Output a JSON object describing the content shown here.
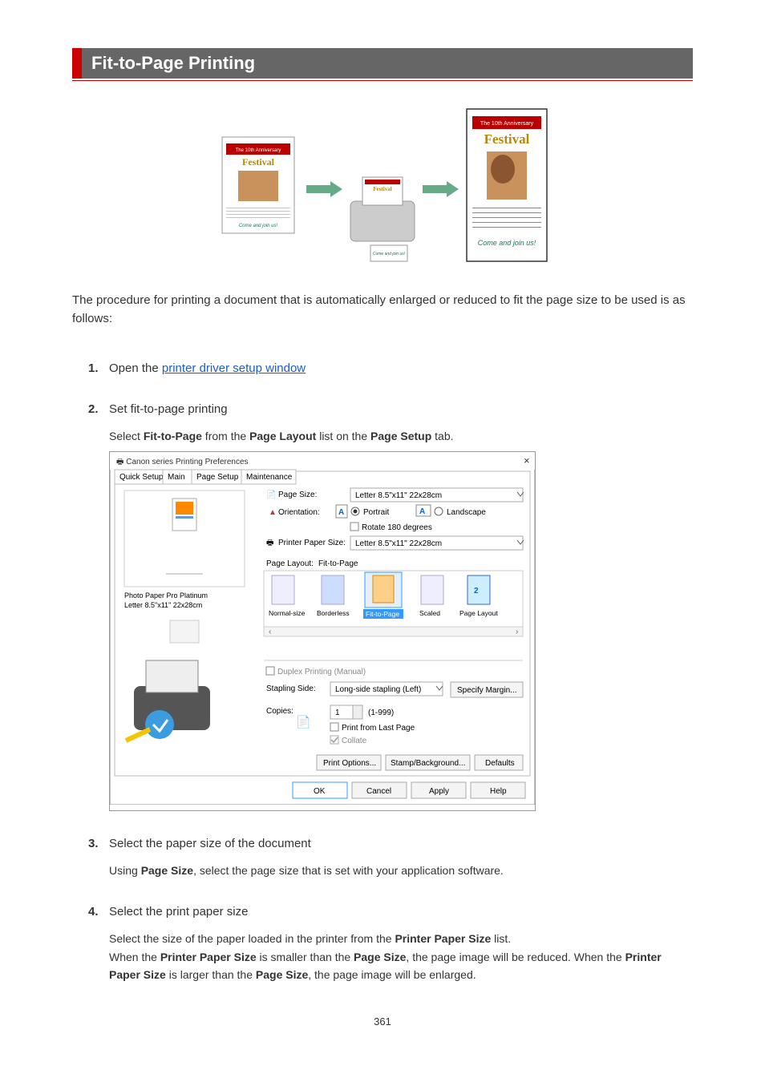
{
  "header": {
    "title": "Fit-to-Page Printing"
  },
  "illustration": {
    "banner_title": "The 10th Anniversary",
    "banner_festival": "Festival",
    "banner_tag": "Come and join us!"
  },
  "intro": "The procedure for printing a document that is automatically enlarged or reduced to fit the page size to be used is as follows:",
  "steps": [
    {
      "num": "1.",
      "title_prefix": "Open the ",
      "title_link": "printer driver setup window",
      "body_html": ""
    },
    {
      "num": "2.",
      "title": "Set fit-to-page printing",
      "body_prefix": "Select ",
      "body_b1": "Fit-to-Page",
      "body_mid": " from the ",
      "body_b2": "Page Layout",
      "body_mid2": " list on the ",
      "body_b3": "Page Setup",
      "body_suffix": " tab."
    },
    {
      "num": "3.",
      "title": "Select the paper size of the document",
      "body_prefix": "Using ",
      "body_b1": "Page Size",
      "body_suffix": ", select the page size that is set with your application software."
    },
    {
      "num": "4.",
      "title": "Select the print paper size",
      "line1_prefix": "Select the size of the paper loaded in the printer from the ",
      "line1_b": "Printer Paper Size",
      "line1_suffix": " list.",
      "line2_prefix": "When the ",
      "line2_b1": "Printer Paper Size",
      "line2_mid1": " is smaller than the ",
      "line2_b2": "Page Size",
      "line2_mid2": ", the page image will be reduced. When the ",
      "line2_b3": "Printer Paper Size",
      "line2_mid3": " is larger than the ",
      "line2_b4": "Page Size",
      "line2_suffix": ", the page image will be enlarged."
    }
  ],
  "dialog": {
    "titlebar": "Canon          series Printing Preferences",
    "tabs": [
      "Quick Setup",
      "Main",
      "Page Setup",
      "Maintenance"
    ],
    "labels": {
      "page_size": "Page Size:",
      "orientation": "Orientation:",
      "portrait": "Portrait",
      "landscape": "Landscape",
      "rotate": "Rotate 180 degrees",
      "printer_paper_size": "Printer Paper Size:",
      "page_layout": "Page Layout:",
      "layout_items": [
        "Normal-size",
        "Borderless",
        "Fit-to-Page",
        "Scaled",
        "Page Layout"
      ],
      "preview_text1": "Photo Paper Pro Platinum",
      "preview_text2": "Letter 8.5\"x11\" 22x28cm",
      "duplex": "Duplex Printing (Manual)",
      "stapling": "Stapling Side:",
      "stapling_value": "Long-side stapling (Left)",
      "specify_margin": "Specify Margin...",
      "copies": "Copies:",
      "copies_value": "1",
      "copies_range": "(1-999)",
      "print_last": "Print from Last Page",
      "collate": "Collate",
      "print_options": "Print Options...",
      "stamp": "Stamp/Background...",
      "defaults": "Defaults",
      "ok": "OK",
      "cancel": "Cancel",
      "apply": "Apply",
      "help": "Help",
      "letter_size": "Letter 8.5\"x11\" 22x28cm"
    }
  },
  "page_number": "361"
}
